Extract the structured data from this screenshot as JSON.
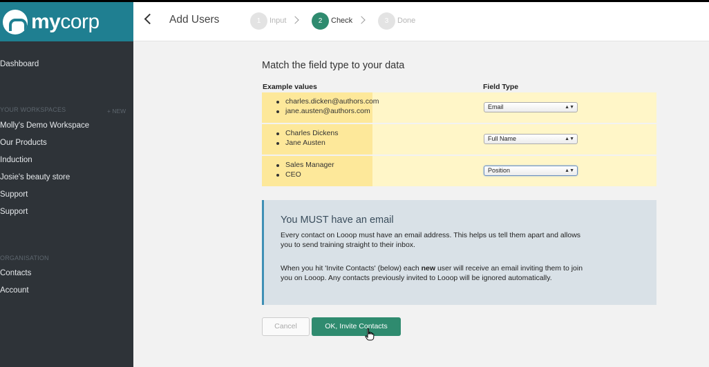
{
  "brand": {
    "name_bold": "my",
    "name_light": "corp"
  },
  "sidebar": {
    "dashboard": "Dashboard",
    "workspaces_heading": "YOUR WORKSPACES",
    "new_label": "+ NEW",
    "workspaces": [
      "Molly's Demo Workspace",
      "Our Products",
      "Induction",
      "Josie's beauty store",
      "Support",
      "Support"
    ],
    "organisation_heading": "ORGANISATION",
    "organisation_items": [
      "Contacts",
      "Account"
    ]
  },
  "header": {
    "title": "Add Users",
    "steps": [
      {
        "num": "1",
        "label": "Input",
        "state": "inactive"
      },
      {
        "num": "2",
        "label": "Check",
        "state": "active"
      },
      {
        "num": "3",
        "label": "Done",
        "state": "inactive"
      }
    ]
  },
  "main": {
    "title": "Match the field type to your data",
    "col_example": "Example values",
    "col_field_type": "Field Type",
    "rows": [
      {
        "examples": [
          "charles.dicken@authors.com",
          "jane.austen@authors.com"
        ],
        "field_type": "Email"
      },
      {
        "examples": [
          "Charles Dickens",
          "Jane Austen"
        ],
        "field_type": "Full Name"
      },
      {
        "examples": [
          "Sales Manager",
          "CEO"
        ],
        "field_type": "Position"
      }
    ]
  },
  "info": {
    "title": "You MUST have an email",
    "p1": "Every contact on Looop must have an email address. This helps us tell them apart and allows you to send training straight to their inbox.",
    "p2_before": "When you hit 'Invite Contacts' (below) each ",
    "p2_bold": "new",
    "p2_after": " user will receive an email inviting them to join you on Looop. Any contacts previously invited to Looop will be ignored automatically."
  },
  "buttons": {
    "cancel": "Cancel",
    "ok": "OK, Invite Contacts"
  },
  "colors": {
    "brand": "#1f7f91",
    "sidebar": "#2e3338",
    "accent": "#2f8b6f",
    "info_border": "#3f8fb5"
  }
}
